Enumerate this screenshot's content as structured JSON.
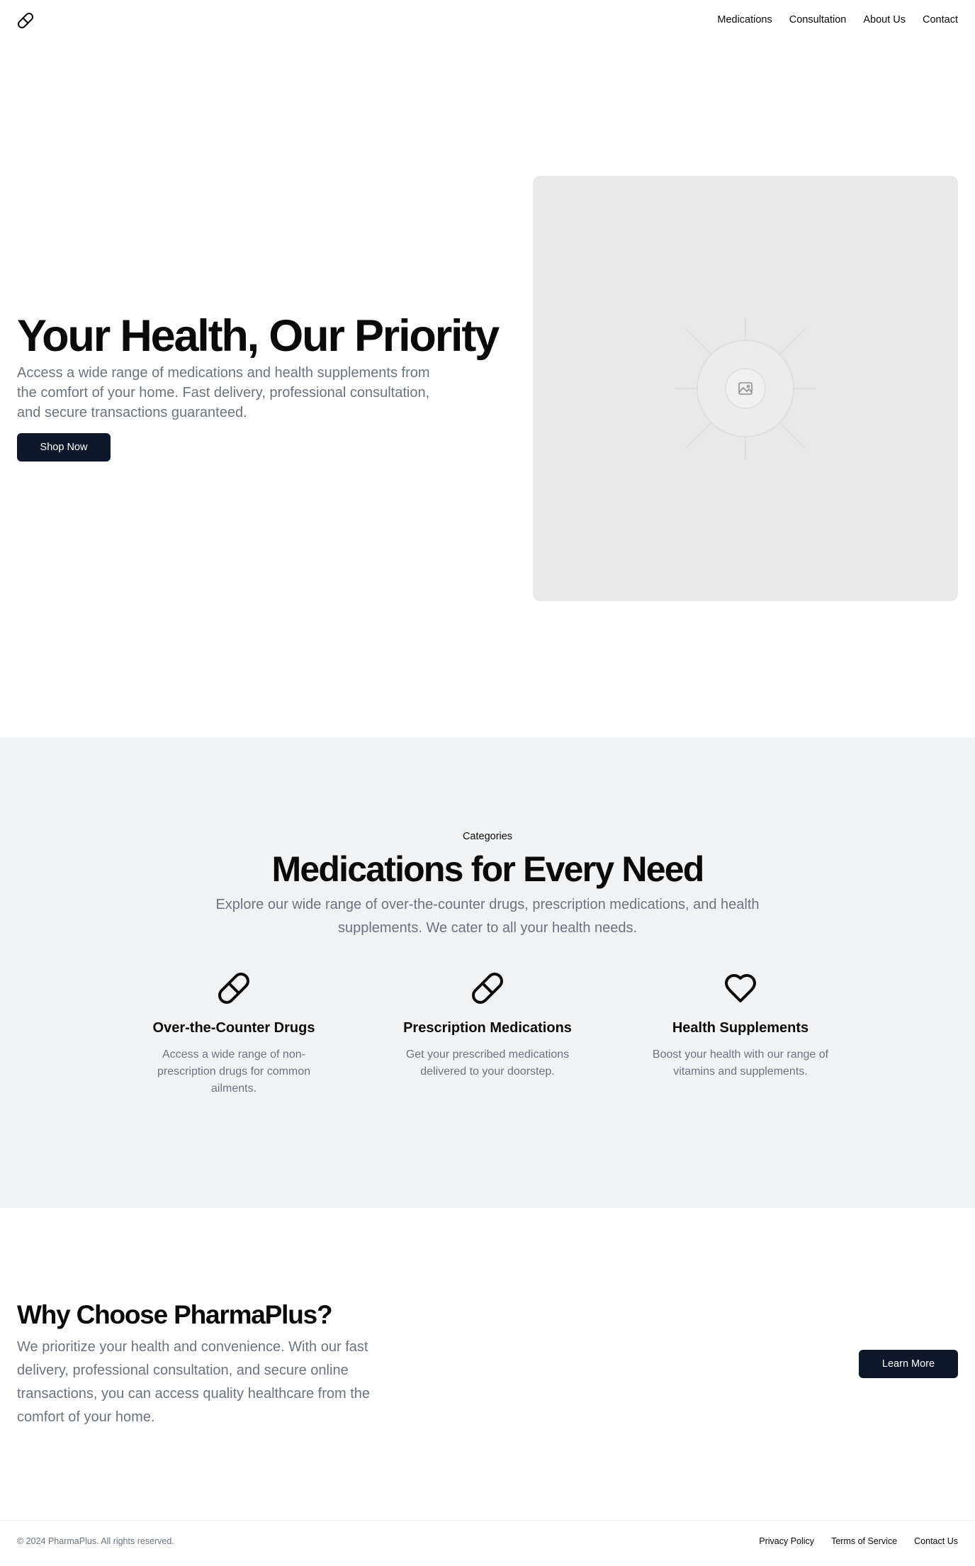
{
  "header": {
    "logo_icon": "pill-icon",
    "nav": [
      "Medications",
      "Consultation",
      "About Us",
      "Contact"
    ]
  },
  "hero": {
    "title": "Your Health, Our Priority",
    "description": "Access a wide range of medications and health supplements from the comfort of your home. Fast delivery, professional consultation, and secure transactions guaranteed.",
    "button": "Shop Now",
    "image_icon": "image-placeholder-icon"
  },
  "categories": {
    "label": "Categories",
    "title": "Medications for Every Need",
    "description": "Explore our wide range of over-the-counter drugs, prescription medications, and health supplements. We cater to all your health needs.",
    "items": [
      {
        "icon": "pill-icon",
        "title": "Over-the-Counter Drugs",
        "text": "Access a wide range of non-prescription drugs for common ailments."
      },
      {
        "icon": "pill-icon",
        "title": "Prescription Medications",
        "text": "Get your prescribed medications delivered to your doorstep."
      },
      {
        "icon": "heart-icon",
        "title": "Health Supplements",
        "text": "Boost your health with our range of vitamins and supplements."
      }
    ]
  },
  "why": {
    "title": "Why Choose PharmaPlus?",
    "description": "We prioritize your health and convenience. With our fast delivery, professional consultation, and secure online transactions, you can access quality healthcare from the comfort of your home.",
    "button": "Learn More"
  },
  "footer": {
    "copyright": "© 2024 PharmaPlus. All rights reserved.",
    "links": [
      "Privacy Policy",
      "Terms of Service",
      "Contact Us"
    ]
  },
  "colors": {
    "primary_button": "#0f172a",
    "muted_text": "#6b7280",
    "section_bg": "#f1f2f4",
    "placeholder_bg": "#e8e8e8"
  }
}
